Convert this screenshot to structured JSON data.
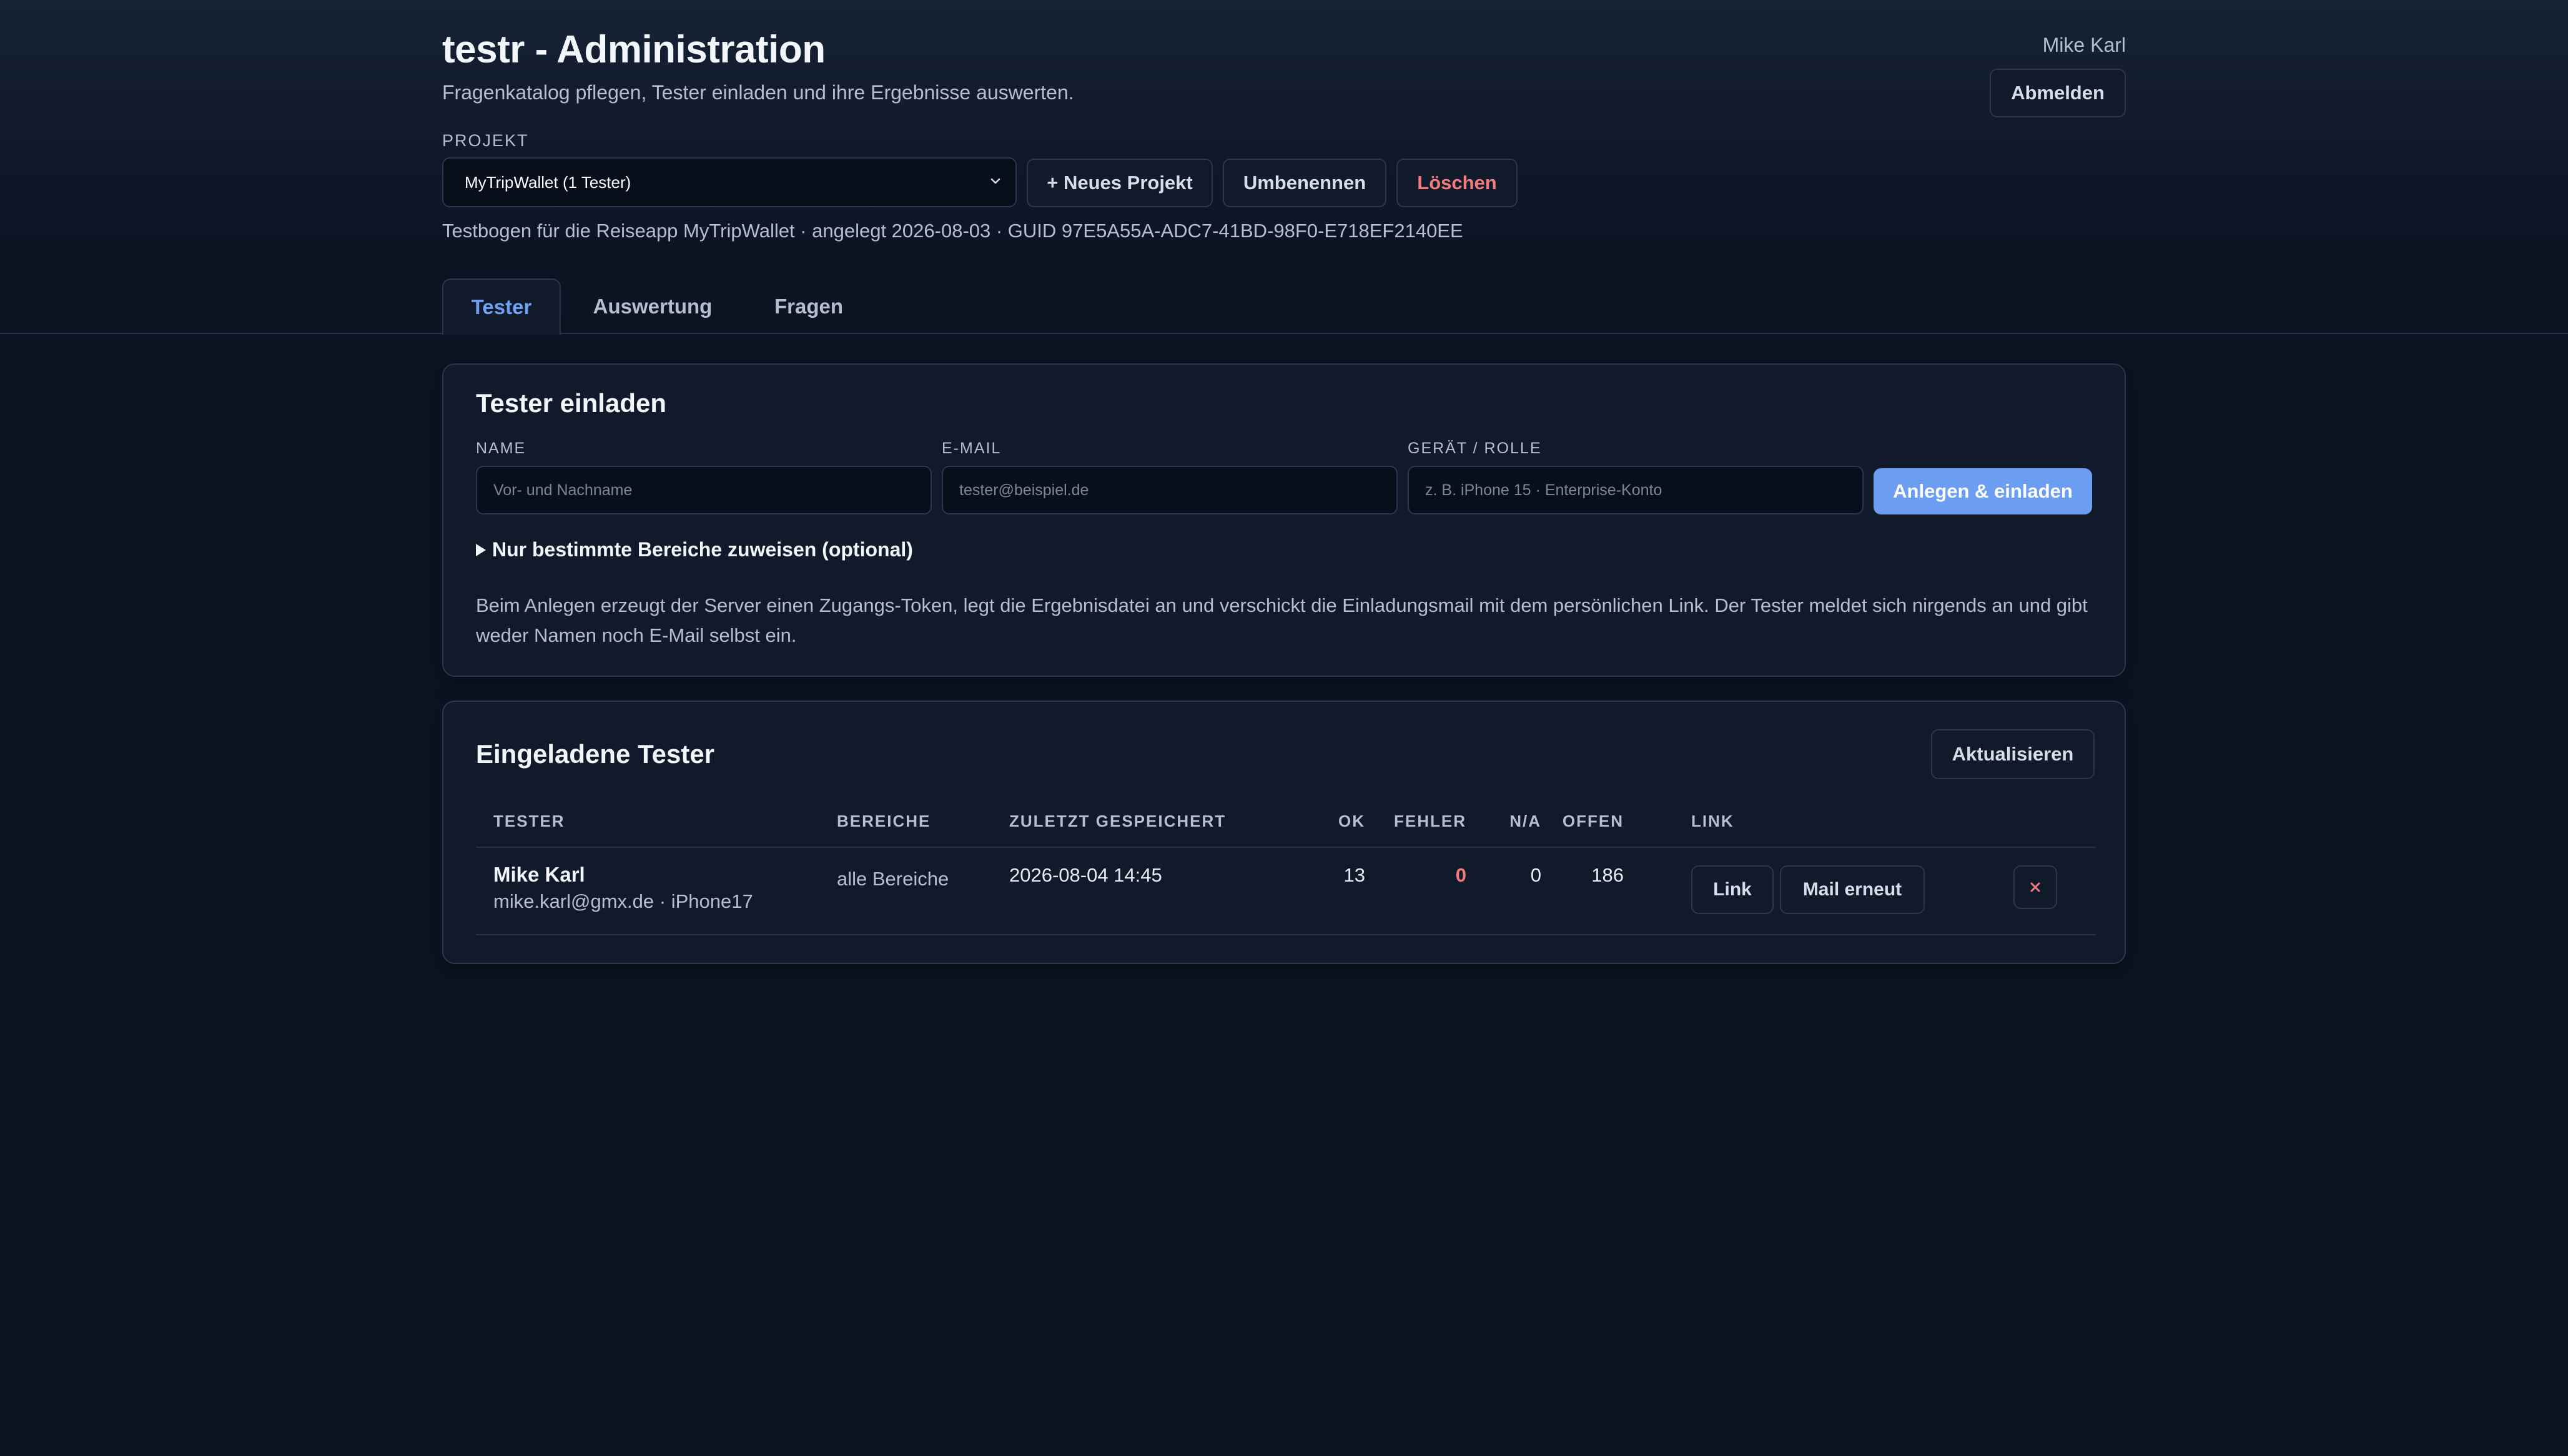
{
  "app": {
    "title": "testr - Administration",
    "subtitle": "Fragenkatalog pflegen, Tester einladen und ihre Ergebnisse auswerten."
  },
  "user": {
    "name": "Mike Karl",
    "logout_label": "Abmelden"
  },
  "project": {
    "label": "PROJEKT",
    "selected": "MyTripWallet (1 Tester)",
    "new_label": "+ Neues Projekt",
    "rename_label": "Umbenennen",
    "delete_label": "Löschen",
    "meta": "Testbogen für die Reiseapp MyTripWallet · angelegt 2026-08-03 · GUID 97E5A55A-ADC7-41BD-98F0-E718EF2140EE"
  },
  "tabs": [
    {
      "label": "Tester",
      "active": true
    },
    {
      "label": "Auswertung",
      "active": false
    },
    {
      "label": "Fragen",
      "active": false
    }
  ],
  "invite": {
    "title": "Tester einladen",
    "fields": [
      {
        "label": "NAME",
        "placeholder": "Vor- und Nachname"
      },
      {
        "label": "E-MAIL",
        "placeholder": "tester@beispiel.de"
      },
      {
        "label": "GERÄT / ROLLE",
        "placeholder": "z. B. iPhone 15 · Enterprise-Konto"
      }
    ],
    "submit_label": "Anlegen & einladen",
    "areas_toggle": "Nur bestimmte Bereiche zuweisen (optional)",
    "info": "Beim Anlegen erzeugt der Server einen Zugangs-Token, legt die Ergebnisdatei an und verschickt die Einladungsmail mit dem persönlichen Link. Der Tester meldet sich nirgends an und gibt weder Namen noch E-Mail selbst ein."
  },
  "testers": {
    "title": "Eingeladene Tester",
    "refresh_label": "Aktualisieren",
    "columns": [
      "TESTER",
      "BEREICHE",
      "ZULETZT GESPEICHERT",
      "OK",
      "FEHLER",
      "N/A",
      "OFFEN",
      "LINK"
    ],
    "rows": [
      {
        "name": "Mike Karl",
        "detail": "mike.karl@gmx.de · iPhone17",
        "areas": "alle Bereiche",
        "last_saved": "2026-08-04 14:45",
        "ok": "13",
        "errors": "0",
        "na": "0",
        "open": "186",
        "link_label": "Link",
        "resend_label": "Mail erneut"
      }
    ]
  },
  "colors": {
    "background": "#0c1322",
    "card": "#111a2b",
    "accent": "#6b9df0",
    "danger": "#f27b7b"
  },
  "icons": {
    "select_chevron": "chevron-down-icon",
    "disclosure": "triangle-right-icon",
    "delete_row": "close-icon"
  }
}
